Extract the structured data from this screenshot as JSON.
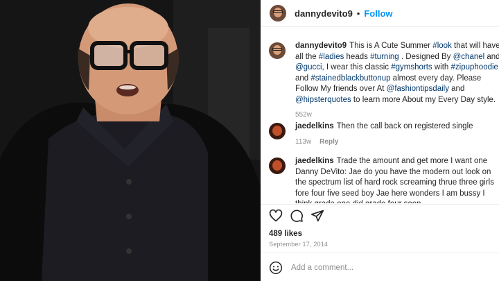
{
  "header": {
    "username": "dannydevito9",
    "separator": "•",
    "follow_label": "Follow"
  },
  "caption": {
    "username": "dannydevito9",
    "segments": [
      {
        "text": "This is A Cute Summer ",
        "tag": false
      },
      {
        "text": "#look",
        "tag": true
      },
      {
        "text": " that will have all the ",
        "tag": false
      },
      {
        "text": "#ladies",
        "tag": true
      },
      {
        "text": " heads ",
        "tag": false
      },
      {
        "text": "#turning",
        "tag": true
      },
      {
        "text": " . Designed By ",
        "tag": false
      },
      {
        "text": "@chanel",
        "tag": true
      },
      {
        "text": " and ",
        "tag": false
      },
      {
        "text": "@gucci",
        "tag": true
      },
      {
        "text": ", I wear this classic ",
        "tag": false
      },
      {
        "text": "#gymshorts",
        "tag": true
      },
      {
        "text": " with ",
        "tag": false
      },
      {
        "text": "#zipuphoodie",
        "tag": true
      },
      {
        "text": " and ",
        "tag": false
      },
      {
        "text": "#stainedblackbuttonup",
        "tag": true
      },
      {
        "text": " almost every day. Please Follow My friends over At ",
        "tag": false
      },
      {
        "text": "@fashiontipsdaily",
        "tag": true
      },
      {
        "text": " and ",
        "tag": false
      },
      {
        "text": "@hipsterquotes",
        "tag": true
      },
      {
        "text": " to learn more About my Every Day style.",
        "tag": false
      }
    ],
    "time": "552w"
  },
  "comments": [
    {
      "username": "jaedelkins",
      "text": "Then the call back on registered single",
      "time": "113w",
      "reply_label": "Reply"
    },
    {
      "username": "jaedelkins",
      "text": "Trade the amount and get more I want one Danny DeVito: Jae do you have the modern out look on the spectrum list of hard rock screaming thrue three girls fore four five seed boy Jae here wonders I am bussy I think grade one did grade four soon"
    }
  ],
  "icons": [
    "heart-icon",
    "comment-icon",
    "share-icon",
    "emoji-icon"
  ],
  "likes": "489 likes",
  "date": "September 17, 2014",
  "add_comment": {
    "placeholder": "Add a comment..."
  },
  "colors": {
    "link": "#0095f6",
    "tag": "#00376b",
    "muted": "#8e8e8e"
  }
}
